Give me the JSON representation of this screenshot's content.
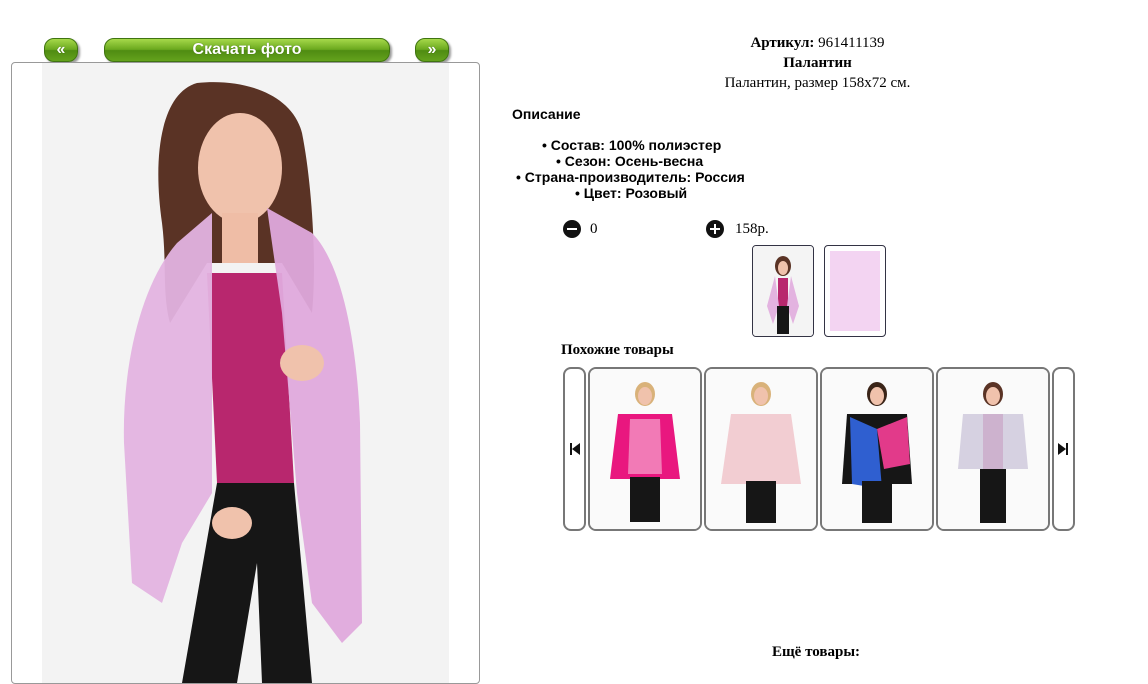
{
  "nav": {
    "prev_label": "«",
    "download_label": "Скачать фото",
    "next_label": "»"
  },
  "product": {
    "article_label": "Артикул:",
    "article_value": "961411139",
    "name": "Палантин",
    "subtitle": "Палантин, размер 158x72 см."
  },
  "description": {
    "title": "Описание",
    "properties": [
      "Состав: 100% полиэстер",
      "Сезон: Осень-весна",
      "Страна-производитель: Россия",
      "Цвет: Розовый"
    ]
  },
  "cart": {
    "quantity": "0",
    "price": "158р."
  },
  "similar": {
    "title": "Похожие товары"
  },
  "more": {
    "title": "Ещё товары:"
  },
  "colors": {
    "accent_green": "#6aa81e",
    "scarf_pink": "#e3b3e0",
    "top_magenta": "#b8276e"
  }
}
